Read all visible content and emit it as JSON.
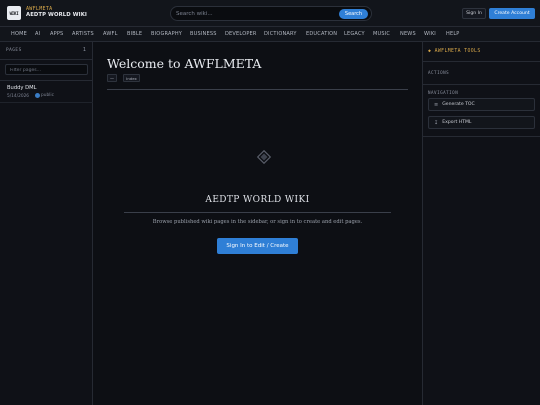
{
  "header": {
    "logo_text": "WIKI",
    "brand_top": "AWFLMETA",
    "brand_main": "AEDTP WORLD WIKI",
    "search_placeholder": "Search wiki...",
    "search_button": "Search",
    "sign_in": "Sign In",
    "create_account": "Create Account"
  },
  "nav": [
    "HOME",
    "AI",
    "APPS",
    "ARTISTS",
    "AWFL",
    "BIBLE",
    "BIOGRAPHY",
    "BUSINESS",
    "DEVELOPER",
    "DICTIONARY",
    "EDUCATION",
    "LEGACY",
    "MUSIC",
    "NEWS",
    "WIKI",
    "HELP"
  ],
  "sidebar": {
    "title": "PAGES",
    "count": "1",
    "filter_placeholder": "Filter pages...",
    "pages": [
      {
        "title": "Buddy DML",
        "date": "5/14/2026",
        "author": "public"
      }
    ]
  },
  "main": {
    "title": "Welcome to AWFLMETA",
    "tool_a": "—",
    "tool_b": "Index",
    "hero_title": "AEDTP WORLD WIKI",
    "hero_sub": "Browse published wiki pages in the sidebar, or sign in to create and edit pages.",
    "hero_button": "Sign In to Edit / Create"
  },
  "tools": {
    "header": "AWFLMETA TOOLS",
    "header_icon": "diamond-icon",
    "actions_label": "ACTIONS",
    "navigation_label": "NAVIGATION",
    "generate_toc": "Generate TOC",
    "generate_toc_icon": "list-icon",
    "export_html": "Export HTML",
    "export_html_icon": "download-icon"
  },
  "colors": {
    "accent": "#2f7fd6",
    "brand_gold": "#d8a84a",
    "background": "#0d0f14"
  }
}
